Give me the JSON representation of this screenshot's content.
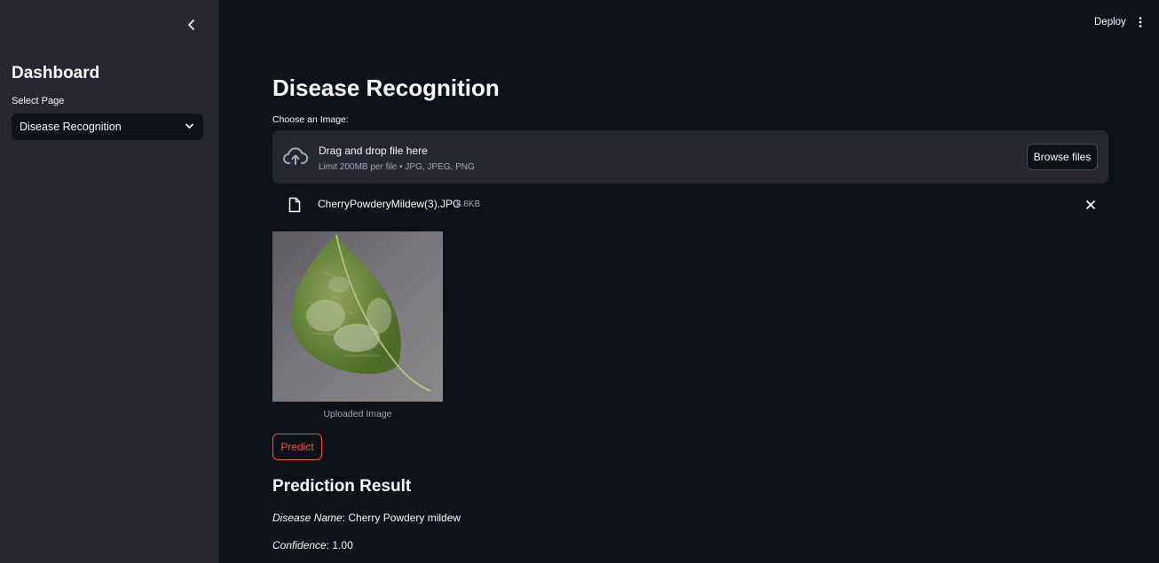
{
  "sidebar": {
    "title": "Dashboard",
    "select_label": "Select Page",
    "select_value": "Disease Recognition"
  },
  "topbar": {
    "deploy_label": "Deploy"
  },
  "main": {
    "title": "Disease Recognition",
    "uploader": {
      "label": "Choose an Image:",
      "drop_text": "Drag and drop file here",
      "limit_text": "Limit 200MB per file • JPG, JPEG, PNG",
      "browse_label": "Browse files"
    },
    "file": {
      "name": "CherryPowderyMildew(3).JPG",
      "size": "8.8KB"
    },
    "image_caption": "Uploaded Image",
    "predict_label": "Predict",
    "result": {
      "title": "Prediction Result",
      "disease_key": "Disease Name",
      "disease_value": ": Cherry Powdery mildew",
      "confidence_key": "Confidence",
      "confidence_value": ": 1.00"
    }
  },
  "colors": {
    "background": "#0e1117",
    "sidebar": "#262730",
    "accent": "#ff4b4b",
    "muted_text": "#a3a8b8"
  }
}
